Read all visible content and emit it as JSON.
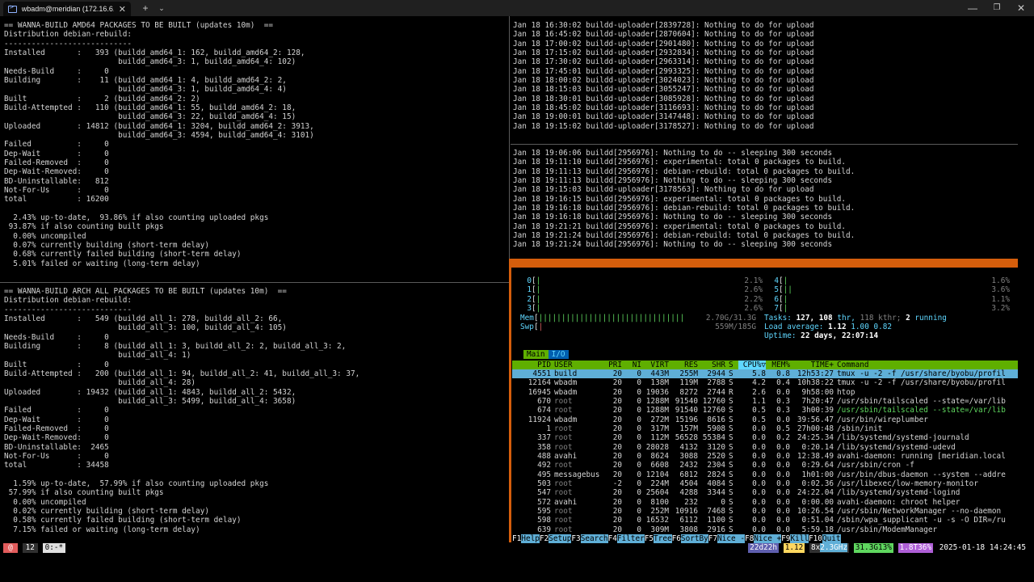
{
  "window": {
    "tab_title": "wbadm@meridian (172.16.6.26",
    "tab_close": "✕",
    "new_tab": "+",
    "tab_menu": "⌄",
    "minimize": "—",
    "maximize": "❐",
    "close": "✕"
  },
  "pane_amd64": [
    "== WANNA-BUILD AMD64 PACKAGES TO BE BUILT (updates 10m)  ==",
    "Distribution debian-rebuild:",
    "----------------------------",
    "Installed       :   393 (buildd_amd64_1: 162, buildd_amd64_2: 128,",
    "                         buildd_amd64_3: 1, buildd_amd64_4: 102)",
    "Needs-Build     :     0",
    "Building        :    11 (buildd_amd64_1: 4, buildd_amd64_2: 2,",
    "                         buildd_amd64_3: 1, buildd_amd64_4: 4)",
    "Built           :     2 (buildd_amd64_2: 2)",
    "Build-Attempted :   110 (buildd_amd64_1: 55, buildd_amd64_2: 18,",
    "                         buildd_amd64_3: 22, buildd_amd64_4: 15)",
    "Uploaded        : 14812 (buildd_amd64_1: 3204, buildd_amd64_2: 3913,",
    "                         buildd_amd64_3: 4594, buildd_amd64_4: 3101)",
    "Failed          :     0",
    "Dep-Wait        :     0",
    "Failed-Removed  :     0",
    "Dep-Wait-Removed:     0",
    "BD-Uninstallable:   812",
    "Not-For-Us      :     0",
    "total           : 16200",
    "",
    "  2.43% up-to-date,  93.86% if also counting uploaded pkgs",
    " 93.87% if also counting built pkgs",
    "  0.00% uncompiled",
    "  0.07% currently building (short-term delay)",
    "  0.68% currently failed building (short-term delay)",
    "  5.01% failed or waiting (long-term delay)"
  ],
  "pane_all": [
    "== WANNA-BUILD ARCH ALL PACKAGES TO BE BUILT (updates 10m)  ==",
    "Distribution debian-rebuild:",
    "----------------------------",
    "Installed       :   549 (buildd_all_1: 278, buildd_all_2: 66,",
    "                         buildd_all_3: 100, buildd_all_4: 105)",
    "Needs-Build     :     0",
    "Building        :     8 (buildd_all_1: 3, buildd_all_2: 2, buildd_all_3: 2,",
    "                         buildd_all_4: 1)",
    "Built           :     0",
    "Build-Attempted :   200 (buildd_all_1: 94, buildd_all_2: 41, buildd_all_3: 37,",
    "                         buildd_all_4: 28)",
    "Uploaded        : 19432 (buildd_all_1: 4843, buildd_all_2: 5432,",
    "                         buildd_all_3: 5499, buildd_all_4: 3658)",
    "Failed          :     0",
    "Dep-Wait        :     0",
    "Failed-Removed  :     0",
    "Dep-Wait-Removed:     0",
    "BD-Uninstallable:  2465",
    "Not-For-Us      :     0",
    "total           : 34458",
    "",
    "  1.59% up-to-date,  57.99% if also counting uploaded pkgs",
    " 57.99% if also counting built pkgs",
    "  0.00% uncompiled",
    "  0.02% currently building (short-term delay)",
    "  0.58% currently failed building (short-term delay)",
    "  7.15% failed or waiting (long-term delay)"
  ],
  "pane_uploader": [
    "Jan 18 16:30:02 buildd-uploader[2839728]: Nothing to do for upload",
    "Jan 18 16:45:02 buildd-uploader[2870604]: Nothing to do for upload",
    "Jan 18 17:00:02 buildd-uploader[2901480]: Nothing to do for upload",
    "Jan 18 17:15:02 buildd-uploader[2932834]: Nothing to do for upload",
    "Jan 18 17:30:02 buildd-uploader[2963314]: Nothing to do for upload",
    "Jan 18 17:45:01 buildd-uploader[2993325]: Nothing to do for upload",
    "Jan 18 18:00:02 buildd-uploader[3024023]: Nothing to do for upload",
    "Jan 18 18:15:03 buildd-uploader[3055247]: Nothing to do for upload",
    "Jan 18 18:30:01 buildd-uploader[3085928]: Nothing to do for upload",
    "Jan 18 18:45:02 buildd-uploader[3116693]: Nothing to do for upload",
    "Jan 18 19:00:01 buildd-uploader[3147448]: Nothing to do for upload",
    "Jan 18 19:15:02 buildd-uploader[3178527]: Nothing to do for upload"
  ],
  "pane_buildd": [
    "Jan 18 19:06:06 buildd[2956976]: Nothing to do -- sleeping 300 seconds",
    "Jan 18 19:11:10 buildd[2956976]: experimental: total 0 packages to build.",
    "Jan 18 19:11:13 buildd[2956976]: debian-rebuild: total 0 packages to build.",
    "Jan 18 19:11:13 buildd[2956976]: Nothing to do -- sleeping 300 seconds",
    "Jan 18 19:15:03 buildd-uploader[3178563]: Nothing to do for upload",
    "Jan 18 19:16:15 buildd[2956976]: experimental: total 0 packages to build.",
    "Jan 18 19:16:18 buildd[2956976]: debian-rebuild: total 0 packages to build.",
    "Jan 18 19:16:18 buildd[2956976]: Nothing to do -- sleeping 300 seconds",
    "Jan 18 19:21:21 buildd[2956976]: experimental: total 0 packages to build.",
    "Jan 18 19:21:24 buildd[2956976]: debian-rebuild: total 0 packages to build.",
    "Jan 18 19:21:24 buildd[2956976]: Nothing to do -- sleeping 300 seconds"
  ],
  "htop": {
    "cpus_left": [
      {
        "id": "0",
        "pct": "2.1%",
        "bars": "|"
      },
      {
        "id": "1",
        "pct": "2.6%",
        "bars": "|"
      },
      {
        "id": "2",
        "pct": "2.2%",
        "bars": "|"
      },
      {
        "id": "3",
        "pct": "2.6%",
        "bars": "|"
      }
    ],
    "cpus_right": [
      {
        "id": "4",
        "pct": "1.6%",
        "bars": "|"
      },
      {
        "id": "5",
        "pct": "3.6%",
        "bars": "||"
      },
      {
        "id": "6",
        "pct": "1.1%",
        "bars": "|"
      },
      {
        "id": "7",
        "pct": "3.2%",
        "bars": "|"
      }
    ],
    "mem_label": "Mem",
    "mem_bars": "||||||||||||||||||||||||||||||||",
    "mem_value": "2.70G/31.3G",
    "swp_label": "Swp",
    "swp_bars": "|",
    "swp_value": "559M/185G",
    "tasks_label": "Tasks:",
    "tasks_count": "127,",
    "thr_count": "108",
    "thr_label": "thr,",
    "kthr": "118 kthr;",
    "running_count": "2",
    "running_label": "running",
    "load_label": "Load average:",
    "load_1": "1.12",
    "load_5": "1.00",
    "load_15": "0.82",
    "uptime_label": "Uptime:",
    "uptime_value": "22 days, 22:07:14",
    "tab_main": "Main",
    "tab_io": "I/O",
    "headers": {
      "pid": "PID",
      "user": "USER",
      "pri": "PRI",
      "ni": "NI",
      "virt": "VIRT",
      "res": "RES",
      "shr": "SHR",
      "s": "S",
      "cpu": "CPU%▽",
      "mem": "MEM%",
      "time": "TIME+",
      "cmd": "Command"
    },
    "processes": [
      {
        "pid": "4551",
        "user": "build",
        "pri": "20",
        "ni": "0",
        "virt": "443M",
        "res": "255M",
        "shr": "2944",
        "s": "S",
        "cpu": "5.8",
        "mem": "0.8",
        "time": "12h53:27",
        "cmd": "tmux -u -2 -f /usr/share/byobu/profil"
      },
      {
        "pid": "12164",
        "user": "wbadm",
        "pri": "20",
        "ni": "0",
        "virt": "138M",
        "res": "119M",
        "shr": "2788",
        "s": "S",
        "cpu": "4.2",
        "mem": "0.4",
        "time": "10h38:22",
        "cmd": "tmux -u -2 -f /usr/share/byobu/profil"
      },
      {
        "pid": "16945",
        "user": "wbadm",
        "pri": "20",
        "ni": "0",
        "virt": "19036",
        "res": "8272",
        "shr": "2744",
        "s": "R",
        "cpu": "2.6",
        "mem": "0.0",
        "time": "9h58:00",
        "cmd": "htop"
      },
      {
        "pid": "670",
        "user": "root",
        "pri": "20",
        "ni": "0",
        "virt": "1288M",
        "res": "91540",
        "shr": "12760",
        "s": "S",
        "cpu": "1.1",
        "mem": "0.3",
        "time": "7h20:47",
        "cmd": "/usr/sbin/tailscaled --state=/var/lib"
      },
      {
        "pid": "674",
        "user": "root",
        "pri": "20",
        "ni": "0",
        "virt": "1288M",
        "res": "91540",
        "shr": "12760",
        "s": "S",
        "cpu": "0.5",
        "mem": "0.3",
        "time": "3h00:39",
        "cmd": "/usr/sbin/tailscaled --state=/var/lib",
        "thread": true
      },
      {
        "pid": "11924",
        "user": "wbadm",
        "pri": "20",
        "ni": "0",
        "virt": "272M",
        "res": "15196",
        "shr": "8616",
        "s": "S",
        "cpu": "0.5",
        "mem": "0.0",
        "time": "39:56.47",
        "cmd": "/usr/bin/wireplumber"
      },
      {
        "pid": "1",
        "user": "root",
        "pri": "20",
        "ni": "0",
        "virt": "317M",
        "res": "157M",
        "shr": "5908",
        "s": "S",
        "cpu": "0.0",
        "mem": "0.5",
        "time": "27h00:48",
        "cmd": "/sbin/init"
      },
      {
        "pid": "337",
        "user": "root",
        "pri": "20",
        "ni": "0",
        "virt": "112M",
        "res": "56528",
        "shr": "55384",
        "s": "S",
        "cpu": "0.0",
        "mem": "0.2",
        "time": "24:25.34",
        "cmd": "/lib/systemd/systemd-journald"
      },
      {
        "pid": "358",
        "user": "root",
        "pri": "20",
        "ni": "0",
        "virt": "28028",
        "res": "4132",
        "shr": "3120",
        "s": "S",
        "cpu": "0.0",
        "mem": "0.0",
        "time": "0:20.14",
        "cmd": "/lib/systemd/systemd-udevd"
      },
      {
        "pid": "488",
        "user": "avahi",
        "pri": "20",
        "ni": "0",
        "virt": "8624",
        "res": "3088",
        "shr": "2520",
        "s": "S",
        "cpu": "0.0",
        "mem": "0.0",
        "time": "12:38.49",
        "cmd": "avahi-daemon: running [meridian.local"
      },
      {
        "pid": "492",
        "user": "root",
        "pri": "20",
        "ni": "0",
        "virt": "6608",
        "res": "2432",
        "shr": "2304",
        "s": "S",
        "cpu": "0.0",
        "mem": "0.0",
        "time": "0:29.64",
        "cmd": "/usr/sbin/cron -f"
      },
      {
        "pid": "495",
        "user": "messagebus",
        "pri": "20",
        "ni": "0",
        "virt": "12104",
        "res": "6812",
        "shr": "2824",
        "s": "S",
        "cpu": "0.0",
        "mem": "0.0",
        "time": "1h01:00",
        "cmd": "/usr/bin/dbus-daemon --system --addre"
      },
      {
        "pid": "503",
        "user": "root",
        "pri": "-2",
        "ni": "0",
        "virt": "224M",
        "res": "4504",
        "shr": "4084",
        "s": "S",
        "cpu": "0.0",
        "mem": "0.0",
        "time": "0:02.36",
        "cmd": "/usr/libexec/low-memory-monitor"
      },
      {
        "pid": "547",
        "user": "root",
        "pri": "20",
        "ni": "0",
        "virt": "25604",
        "res": "4288",
        "shr": "3344",
        "s": "S",
        "cpu": "0.0",
        "mem": "0.0",
        "time": "24:22.04",
        "cmd": "/lib/systemd/systemd-logind"
      },
      {
        "pid": "572",
        "user": "avahi",
        "pri": "20",
        "ni": "0",
        "virt": "8100",
        "res": "232",
        "shr": "0",
        "s": "S",
        "cpu": "0.0",
        "mem": "0.0",
        "time": "0:00.00",
        "cmd": "avahi-daemon: chroot helper"
      },
      {
        "pid": "595",
        "user": "root",
        "pri": "20",
        "ni": "0",
        "virt": "252M",
        "res": "10916",
        "shr": "7468",
        "s": "S",
        "cpu": "0.0",
        "mem": "0.0",
        "time": "10:26.54",
        "cmd": "/usr/sbin/NetworkManager --no-daemon"
      },
      {
        "pid": "598",
        "user": "root",
        "pri": "20",
        "ni": "0",
        "virt": "16532",
        "res": "6112",
        "shr": "1100",
        "s": "S",
        "cpu": "0.0",
        "mem": "0.0",
        "time": "0:51.04",
        "cmd": "/sbin/wpa_supplicant -u -s -O DIR=/ru"
      },
      {
        "pid": "639",
        "user": "root",
        "pri": "20",
        "ni": "0",
        "virt": "309M",
        "res": "3808",
        "shr": "2916",
        "s": "S",
        "cpu": "0.0",
        "mem": "0.0",
        "time": "5:59.18",
        "cmd": "/usr/sbin/ModemManager"
      }
    ],
    "fkeys": [
      {
        "key": "F1",
        "label": "Help  "
      },
      {
        "key": "F2",
        "label": "Setup "
      },
      {
        "key": "F3",
        "label": "Search"
      },
      {
        "key": "F4",
        "label": "Filter"
      },
      {
        "key": "F5",
        "label": "Tree  "
      },
      {
        "key": "F6",
        "label": "SortBy"
      },
      {
        "key": "F7",
        "label": "Nice -"
      },
      {
        "key": "F8",
        "label": "Nice +"
      },
      {
        "key": "F9",
        "label": "Kill  "
      },
      {
        "key": "F10",
        "label": "Quit  "
      }
    ]
  },
  "status": {
    "logo": "@",
    "session": "12",
    "window": "0:-*",
    "uptime": "22d22h",
    "load": "1.12",
    "cpu_cores": "8x",
    "cpu_freq": "2.3GHz",
    "mem": "31.3G13%",
    "disk": "1.8T36%",
    "datetime": "2025-01-18 14:24:45"
  }
}
